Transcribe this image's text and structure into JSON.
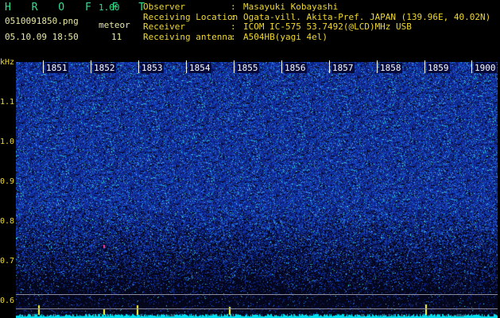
{
  "header": {
    "app_title": "H R O F F T",
    "version": "1.00",
    "filename": "0510091850.png",
    "datetime": "05.10.09 18:50",
    "meteor_label": "meteor",
    "meteor_count": "11"
  },
  "info": [
    {
      "key": "Observer",
      "sep": ":",
      "value": "Masayuki Kobayashi"
    },
    {
      "key": "Receiving Location",
      "sep": ":",
      "value": "Ogata-vill. Akita-Pref. JAPAN (139.96E, 40.02N)"
    },
    {
      "key": "Receiver",
      "sep": ":",
      "value": "ICOM IC-575 53.7492(@LCD)MHz USB"
    },
    {
      "key": "Receiving antenna",
      "sep": ":",
      "value": "A504HB(yagi 4el)"
    }
  ],
  "spectrogram": {
    "y_unit": "kHz",
    "y_ticks": [
      "1.1",
      "1.0",
      "0.9",
      "0.8",
      "0.7",
      "0.6"
    ],
    "time_ticks": [
      "1851",
      "1852",
      "1853",
      "1854",
      "1855",
      "1856",
      "1857",
      "1858",
      "1859",
      "1900"
    ],
    "colors": {
      "background": "#05082a",
      "noise_low": "#1a2aa0",
      "noise_high": "#3ad0d0",
      "baseline": "#00e8ff",
      "marker": "#ffff40",
      "label": "#f0d830"
    }
  }
}
